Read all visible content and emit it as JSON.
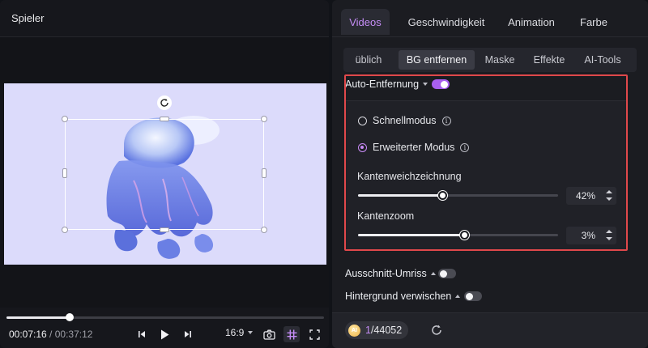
{
  "player": {
    "title": "Spieler",
    "current_time": "00:07:16",
    "separator": " / ",
    "total_time": "00:37:12",
    "progress_fraction": 0.2,
    "aspect_ratio": "16:9",
    "icons": [
      "rotate-icon",
      "previous-frame-icon",
      "play-icon",
      "next-frame-icon",
      "chevron-down-icon",
      "camera-icon",
      "grid-icon",
      "fullscreen-icon"
    ]
  },
  "tabs": [
    {
      "label": "Videos",
      "active": true
    },
    {
      "label": "Geschwindigkeit",
      "active": false
    },
    {
      "label": "Animation",
      "active": false
    },
    {
      "label": "Farbe",
      "active": false
    }
  ],
  "subtabs": [
    {
      "label": "üblich",
      "active": false
    },
    {
      "label": "BG entfernen",
      "active": true
    },
    {
      "label": "Maske",
      "active": false
    },
    {
      "label": "Effekte",
      "active": false
    },
    {
      "label": "AI-Tools",
      "active": false
    }
  ],
  "auto_removal": {
    "label": "Auto-Entfernung",
    "enabled": true,
    "modes": [
      {
        "label": "Schnellmodus",
        "selected": false
      },
      {
        "label": "Erweiterter Modus",
        "selected": true
      }
    ],
    "feather": {
      "label": "Kantenweichzeichnung",
      "value": 42,
      "display": "42%"
    },
    "zoom": {
      "label": "Kantenzoom",
      "value": 3,
      "display": "3%"
    }
  },
  "cutout_outline": {
    "label": "Ausschnitt-Umriss",
    "enabled": false
  },
  "blur_background": {
    "label": "Hintergrund verwischen",
    "enabled": false
  },
  "footer": {
    "credits_used": "1",
    "credits_total": "/44052",
    "coin_label": "AI"
  },
  "colors": {
    "accent": "#a85ff0",
    "accent_text": "#c58df6",
    "highlight_border": "#e0484b",
    "canvas_bg": "#dcdbfb"
  }
}
